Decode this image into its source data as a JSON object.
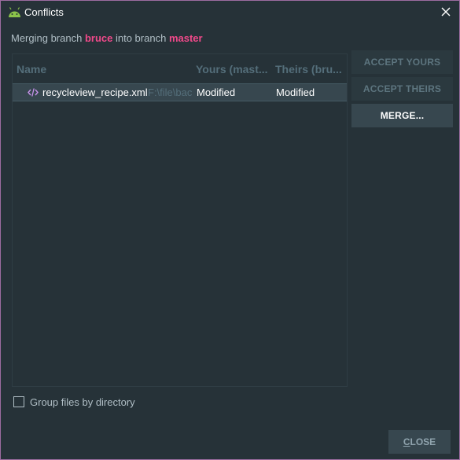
{
  "window": {
    "title": "Conflicts"
  },
  "merge_info": {
    "prefix": "Merging branch",
    "source_branch": "bruce",
    "middle": "into branch",
    "target_branch": "master",
    "branch_color": "#f0498a"
  },
  "table": {
    "columns": [
      "Name",
      "Yours (mast...",
      "Theirs (bru..."
    ],
    "rows": [
      {
        "icon": "xml-code-icon",
        "name": "recycleview_recipe.xml",
        "path": "F:\\file\\bac",
        "yours": "Modified",
        "theirs": "Modified"
      }
    ]
  },
  "actions": {
    "accept_yours": "ACCEPT YOURS",
    "accept_theirs": "ACCEPT THEIRS",
    "merge": "MERGE..."
  },
  "options": {
    "group_by_directory_label": "Group files by directory",
    "group_by_directory_checked": false
  },
  "footer": {
    "close_mnemonic": "C",
    "close_rest": "LOSE"
  }
}
